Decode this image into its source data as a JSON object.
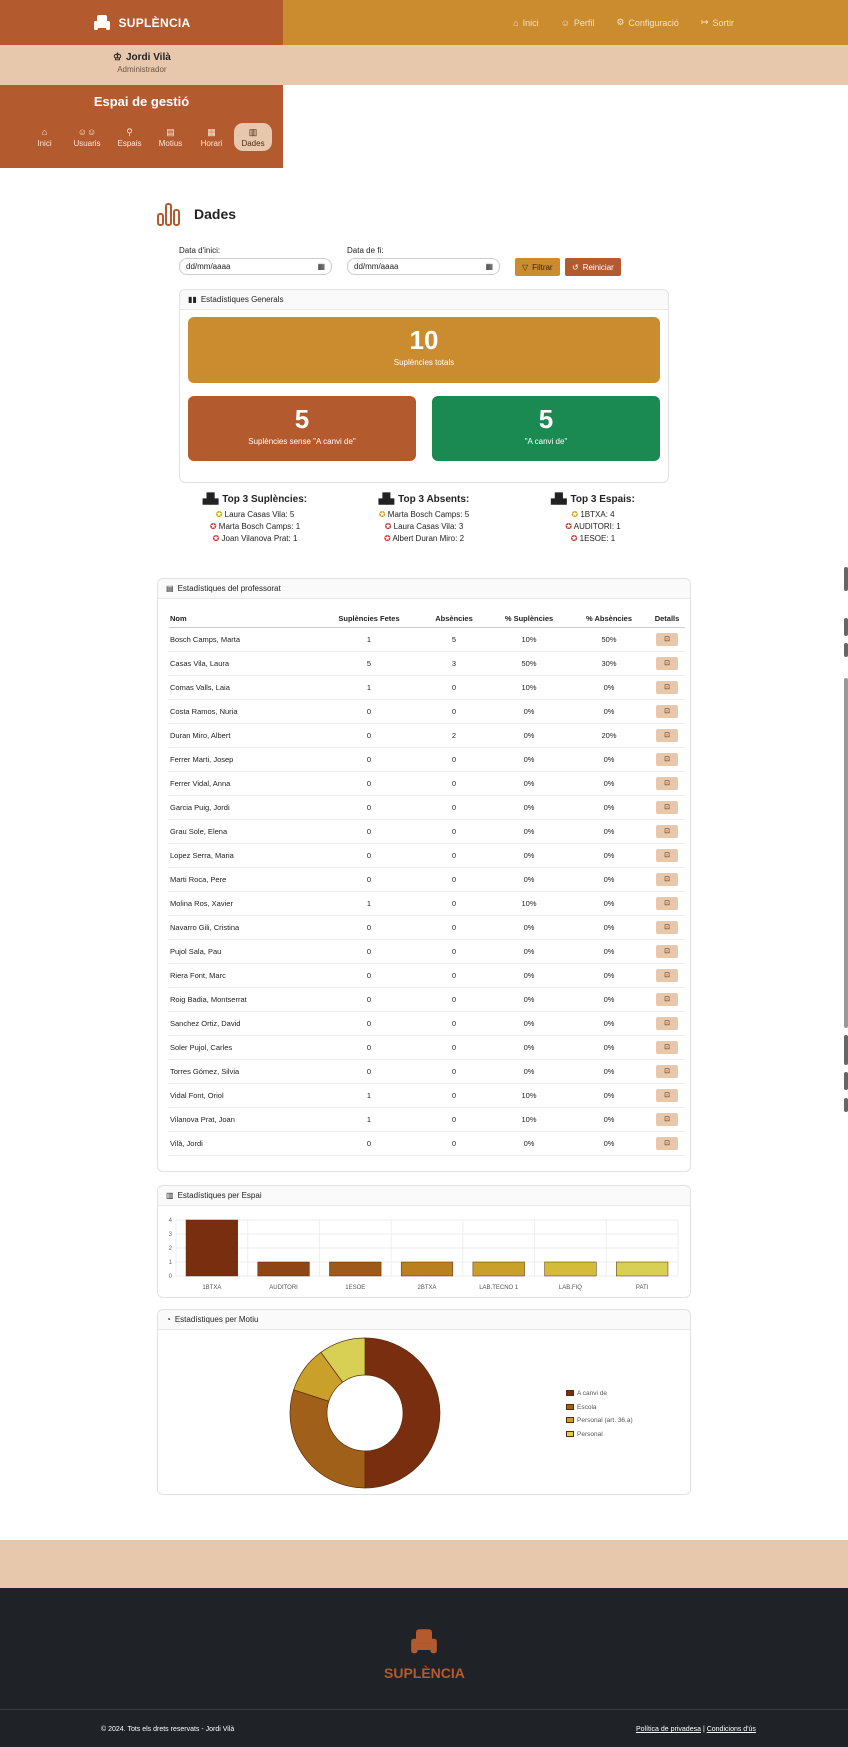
{
  "brand": "SUPLÈNCIA",
  "nav": [
    {
      "label": "Inici",
      "icon": "home-icon"
    },
    {
      "label": "Perfil",
      "icon": "user-icon"
    },
    {
      "label": "Configuració",
      "icon": "gear-icon"
    },
    {
      "label": "Sortir",
      "icon": "logout-icon"
    }
  ],
  "user": {
    "name": "Jordi Vilà",
    "role": "Administrador"
  },
  "management": {
    "title": "Espai de gestió",
    "tabs": [
      {
        "label": "Inici",
        "icon": "home-icon"
      },
      {
        "label": "Usuaris",
        "icon": "users-icon"
      },
      {
        "label": "Espais",
        "icon": "location-icon"
      },
      {
        "label": "Motius",
        "icon": "clipboard-icon"
      },
      {
        "label": "Horari",
        "icon": "calendar-icon"
      },
      {
        "label": "Dades",
        "icon": "chart-icon",
        "active": true
      }
    ]
  },
  "page": {
    "title": "Dades"
  },
  "filters": {
    "start_label": "Data d'inici:",
    "end_label": "Data de fi:",
    "start_placeholder": "dd/mm/aaaa",
    "end_placeholder": "dd/mm/aaaa",
    "filter_button": "Filtrar",
    "reset_button": "Reiniciar"
  },
  "general": {
    "title": "Estadístiques Generals",
    "total_value": "10",
    "total_label": "Suplències totals",
    "without_value": "5",
    "without_label": "Suplències sense \"A canvi de\"",
    "exchange_value": "5",
    "exchange_label": "\"A canvi de\""
  },
  "top3": [
    {
      "title": "Top 3 Suplències:",
      "items": [
        "Laura Casas Vila: 5",
        "Marta Bosch Camps: 1",
        "Joan Vilanova Prat: 1"
      ]
    },
    {
      "title": "Top 3 Absents:",
      "items": [
        "Marta Bosch Camps: 5",
        "Laura Casas Vila: 3",
        "Albert Duran Miro: 2"
      ]
    },
    {
      "title": "Top 3 Espais:",
      "items": [
        "1BTXA: 4",
        "AUDITORI: 1",
        "1ESOE: 1"
      ]
    }
  ],
  "teachers": {
    "title": "Estadístiques del professorat",
    "columns": [
      "Nom",
      "Suplències Fetes",
      "Absències",
      "% Suplències",
      "% Absències",
      "Detalls"
    ],
    "rows": [
      [
        "Bosch Camps, Marta",
        "1",
        "5",
        "10%",
        "50%"
      ],
      [
        "Casas Vila, Laura",
        "5",
        "3",
        "50%",
        "30%"
      ],
      [
        "Comas Valls, Laia",
        "1",
        "0",
        "10%",
        "0%"
      ],
      [
        "Costa Ramos, Nuria",
        "0",
        "0",
        "0%",
        "0%"
      ],
      [
        "Duran Miro, Albert",
        "0",
        "2",
        "0%",
        "20%"
      ],
      [
        "Ferrer Marti, Josep",
        "0",
        "0",
        "0%",
        "0%"
      ],
      [
        "Ferrer Vidal, Anna",
        "0",
        "0",
        "0%",
        "0%"
      ],
      [
        "Garcia Puig, Jordi",
        "0",
        "0",
        "0%",
        "0%"
      ],
      [
        "Grau Sole, Elena",
        "0",
        "0",
        "0%",
        "0%"
      ],
      [
        "Lopez Serra, Maria",
        "0",
        "0",
        "0%",
        "0%"
      ],
      [
        "Marti Roca, Pere",
        "0",
        "0",
        "0%",
        "0%"
      ],
      [
        "Molina Ros, Xavier",
        "1",
        "0",
        "10%",
        "0%"
      ],
      [
        "Navarro Gili, Cristina",
        "0",
        "0",
        "0%",
        "0%"
      ],
      [
        "Pujol Sala, Pau",
        "0",
        "0",
        "0%",
        "0%"
      ],
      [
        "Riera Font, Marc",
        "0",
        "0",
        "0%",
        "0%"
      ],
      [
        "Roig Badia, Montserrat",
        "0",
        "0",
        "0%",
        "0%"
      ],
      [
        "Sanchez Ortiz, David",
        "0",
        "0",
        "0%",
        "0%"
      ],
      [
        "Soler Pujol, Carles",
        "0",
        "0",
        "0%",
        "0%"
      ],
      [
        "Torres Gómez, Silvia",
        "0",
        "0",
        "0%",
        "0%"
      ],
      [
        "Vidal Font, Oriol",
        "1",
        "0",
        "10%",
        "0%"
      ],
      [
        "Vilanova Prat, Joan",
        "1",
        "0",
        "10%",
        "0%"
      ],
      [
        "Vilà, Jordi",
        "0",
        "0",
        "0%",
        "0%"
      ]
    ]
  },
  "space_card_title": "Estadístiques per Espai",
  "motive_card_title": "Estadístiques per Motiu",
  "chart_data": [
    {
      "type": "bar",
      "title": "",
      "categories": [
        "1BTXA",
        "AUDITORI",
        "1ESOE",
        "2BTXA",
        "LAB.TECNO 1",
        "LAB.FIQ",
        "PATI"
      ],
      "values": [
        4,
        1,
        1,
        1,
        1,
        1,
        1
      ],
      "colors": [
        "#7a2e10",
        "#8f4515",
        "#9e5a1a",
        "#b8801f",
        "#c9a02a",
        "#d4bb3a",
        "#d8d055"
      ],
      "ylim": [
        0,
        4
      ],
      "yticks": [
        "0",
        "1",
        "2",
        "3",
        "4"
      ],
      "grid": true
    },
    {
      "type": "pie",
      "title": "",
      "labels": [
        "A canvi de",
        "Escola",
        "Personal (art. 36.a)",
        "Personal"
      ],
      "values": [
        5,
        3,
        1,
        1
      ],
      "colors": [
        "#7a2e10",
        "#a0601a",
        "#c9a02a",
        "#d8d055"
      ],
      "legend": "right"
    }
  ],
  "footer": {
    "brand": "SUPLÈNCIA",
    "copyright": "© 2024. Tots els drets reservats - Jordi Vilà",
    "privacy": "Política de privadesa",
    "separator": "|",
    "terms": "Condicions d'ús"
  }
}
